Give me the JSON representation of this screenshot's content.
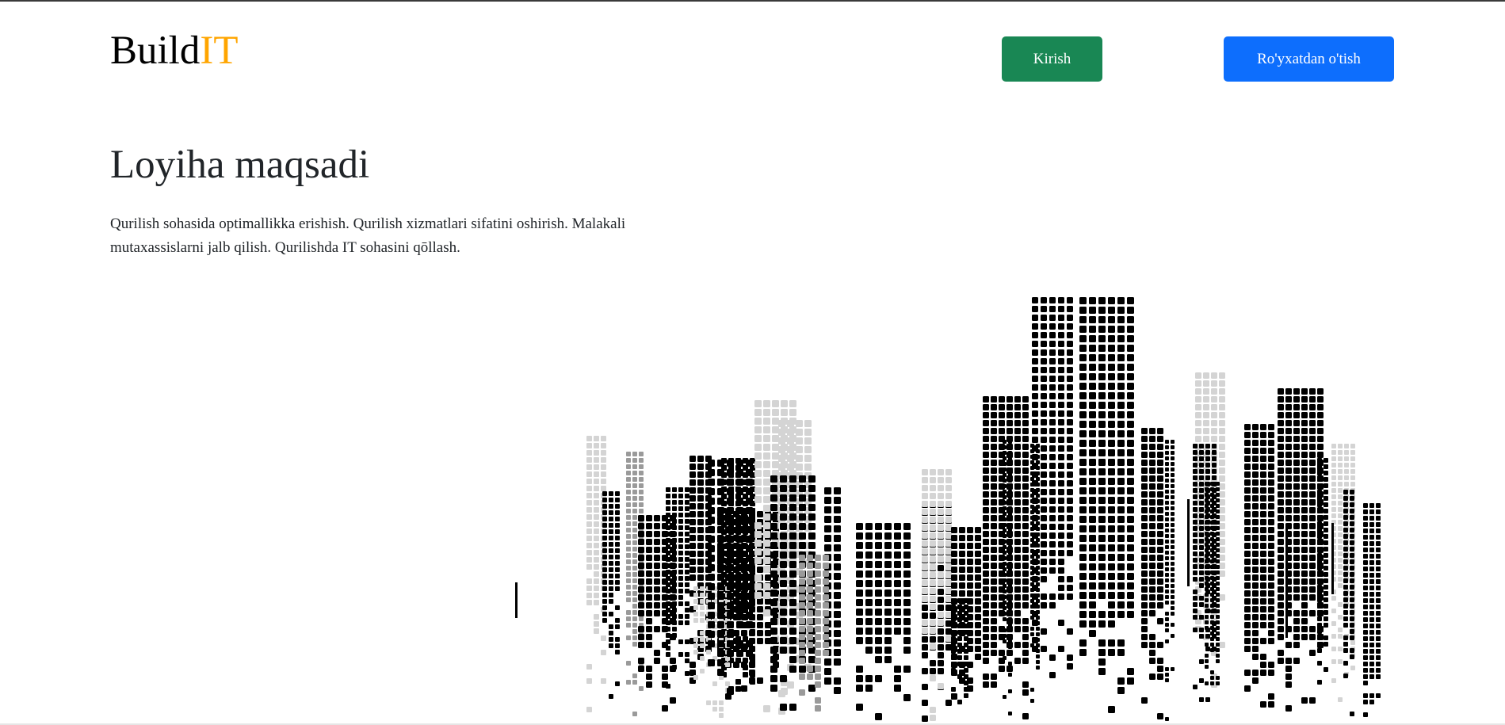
{
  "header": {
    "logo_main": "Build",
    "logo_accent": "IT",
    "login_label": "Kirish",
    "signup_label": "Ro'yxatdan o'tish"
  },
  "hero": {
    "title": "Loyiha maqsadi",
    "description": "Qurilish sohasida optimallikka erishish. Qurilish xizmatlari sifatini oshirish. Malakali mutaxassislarni jalb qilish. Qurilishda IT sohasini qōllash."
  },
  "colors": {
    "accent": "#FFA500",
    "login_button": "#198754",
    "signup_button": "#0d6efd",
    "building_dark": "#000000",
    "building_mid": "#9a9a9a",
    "building_light": "#d4d4d4"
  },
  "illustration": {
    "icon": "city-skyline-illustration"
  }
}
